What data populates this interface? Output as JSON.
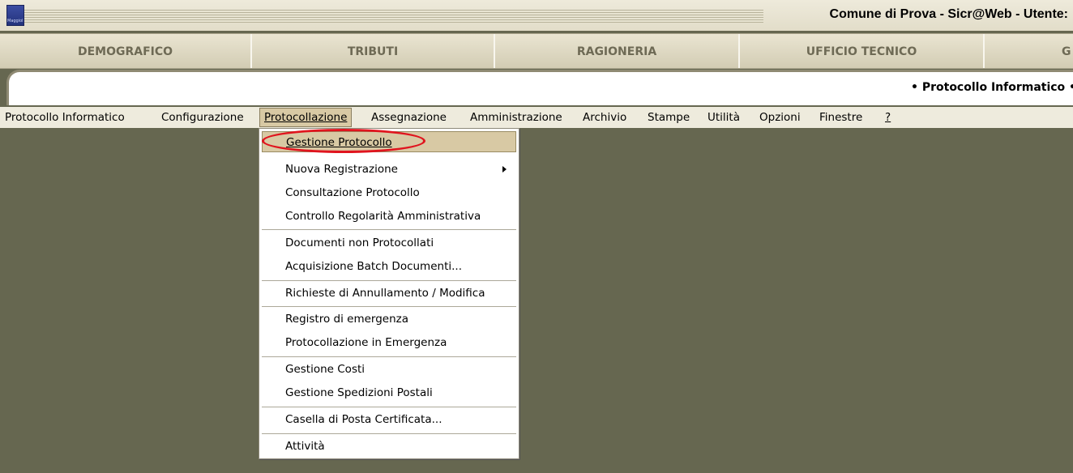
{
  "app": {
    "logo_icon": "maggioli-logo-icon",
    "logo_text": "Maggioli",
    "title": "Comune di Prova  -  Sicr@Web  -  Utente:"
  },
  "modules": [
    "DEMOGRAFICO",
    "TRIBUTI",
    "RAGIONERIA",
    "UFFICIO TECNICO",
    "G"
  ],
  "section": {
    "title": "• Protocollo Informatico •"
  },
  "menu": {
    "items": [
      "Protocollo Informatico",
      "Configurazione",
      "Protocollazione",
      "Assegnazione",
      "Amministrazione",
      "Archivio",
      "Stampe",
      "Utilità",
      "Opzioni",
      "Finestre",
      "?"
    ],
    "active": "Protocollazione"
  },
  "dropdown": {
    "items": [
      "Gestione Protocollo",
      "Nuova Registrazione",
      "Consultazione Protocollo",
      "Controllo Regolarità Amministrativa",
      "Documenti non Protocollati",
      "Acquisizione Batch Documenti...",
      "Richieste di Annullamento / Modifica",
      "Registro di emergenza",
      "Protocollazione in Emergenza",
      "Gestione Costi",
      "Gestione Spedizioni Postali",
      "Casella di Posta Certificata...",
      "Attività"
    ],
    "selected": "Gestione Protocollo",
    "submenu_item": "Nuova Registrazione",
    "highlight_color": "#e0141e"
  },
  "colors": {
    "workspace": "#666750",
    "selection": "#d8c9a4"
  }
}
